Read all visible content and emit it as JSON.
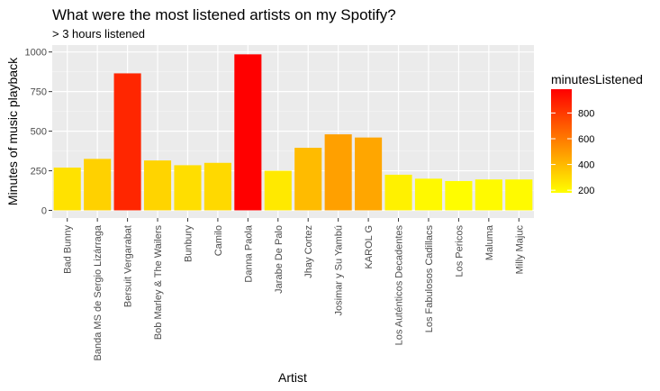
{
  "chart_data": {
    "type": "bar",
    "title": "What were the most listened artists on my Spotify?",
    "subtitle": "> 3 hours listened",
    "xlabel": "Artist",
    "ylabel": "Minutes of music playback",
    "ylim": [
      0,
      1000
    ],
    "yticks": [
      0,
      250,
      500,
      750,
      1000
    ],
    "categories": [
      "Bad Bunny",
      "Banda MS de Sergio Lizárraga",
      "Bersuit Vergarabat",
      "Bob Marley & The Wailers",
      "Bunbury",
      "Camilo",
      "Danna Paola",
      "Jarabe De Palo",
      "Jhay Cortez",
      "Josimar y Su Yambú",
      "KAROL G",
      "Los Auténticos Decadentes",
      "Los Fabulosos Cadillacs",
      "Los Pericos",
      "Maluma",
      "Milly Majuc"
    ],
    "values": [
      270,
      325,
      865,
      315,
      285,
      300,
      985,
      250,
      395,
      480,
      460,
      225,
      200,
      185,
      195,
      195
    ],
    "grid": true,
    "legend": {
      "title": "minutesListened",
      "position": "right",
      "ticks": [
        200,
        400,
        600,
        800
      ],
      "range": [
        180,
        985
      ],
      "colors": [
        "#ffff00",
        "#ff0000"
      ]
    }
  }
}
